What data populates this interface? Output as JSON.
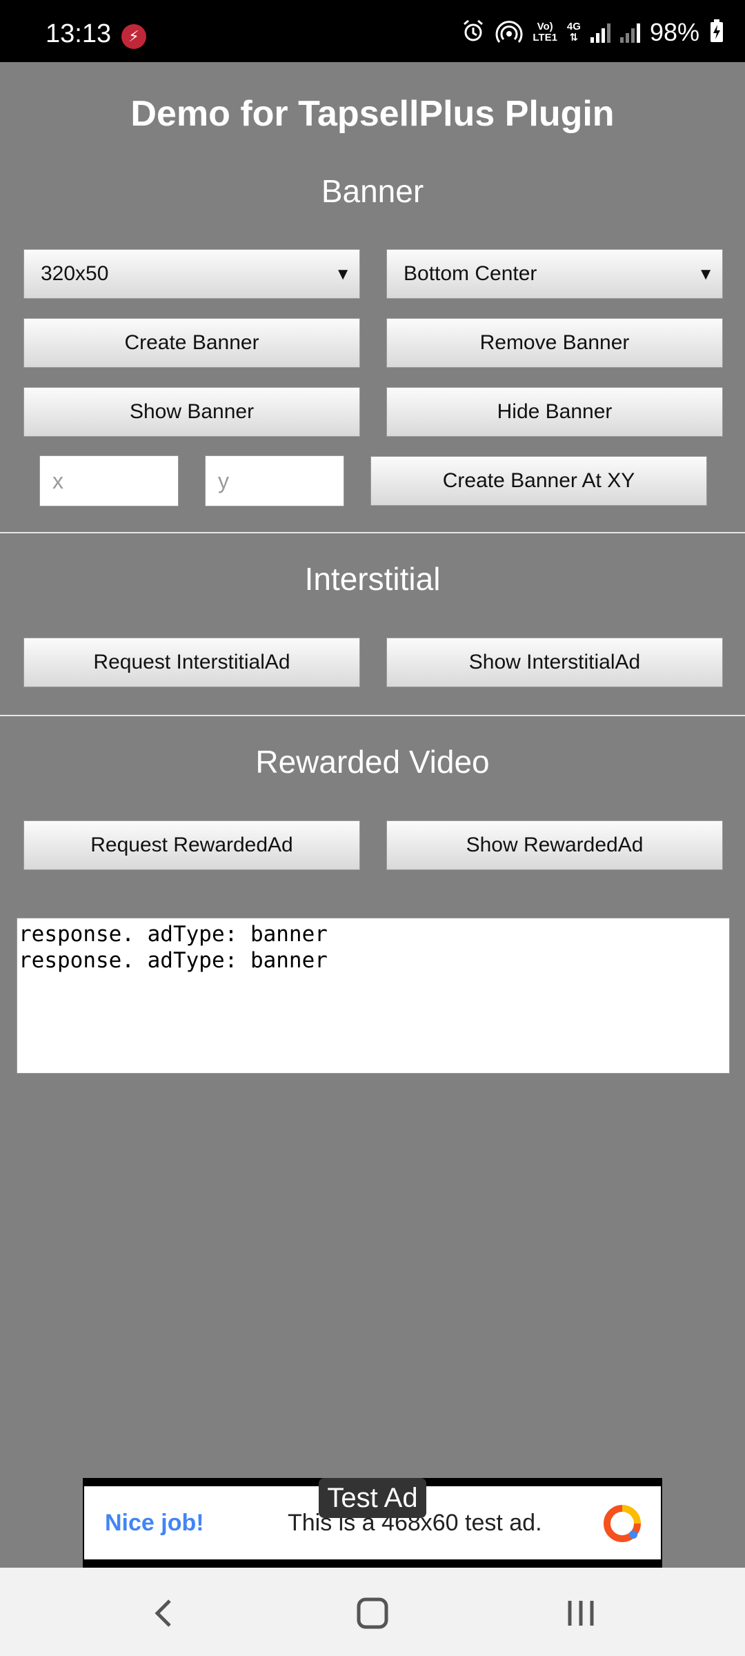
{
  "status_bar": {
    "time": "13:13",
    "net_label_top": "Vo)",
    "net_label_bottom": "LTE1",
    "net_type": "4G",
    "battery_pct": "98%"
  },
  "title": "Demo for TapsellPlus Plugin",
  "banner": {
    "heading": "Banner",
    "size_select": "320x50",
    "position_select": "Bottom Center",
    "create_label": "Create Banner",
    "remove_label": "Remove Banner",
    "show_label": "Show Banner",
    "hide_label": "Hide Banner",
    "x_placeholder": "x",
    "y_placeholder": "y",
    "create_xy_label": "Create Banner At XY"
  },
  "interstitial": {
    "heading": "Interstitial",
    "request_label": "Request InterstitialAd",
    "show_label": "Show InterstitialAd"
  },
  "rewarded": {
    "heading": "Rewarded Video",
    "request_label": "Request RewardedAd",
    "show_label": "Show RewardedAd"
  },
  "log": {
    "lines": [
      "response. adType: banner",
      "response. adType: banner"
    ]
  },
  "ad": {
    "test_label": "Test Ad",
    "nice": "Nice job!",
    "text": "This is a 468x60 test ad."
  },
  "colors": {
    "background": "#808080",
    "ad_nice": "#4285f4",
    "status_alert": "#c0283a"
  }
}
